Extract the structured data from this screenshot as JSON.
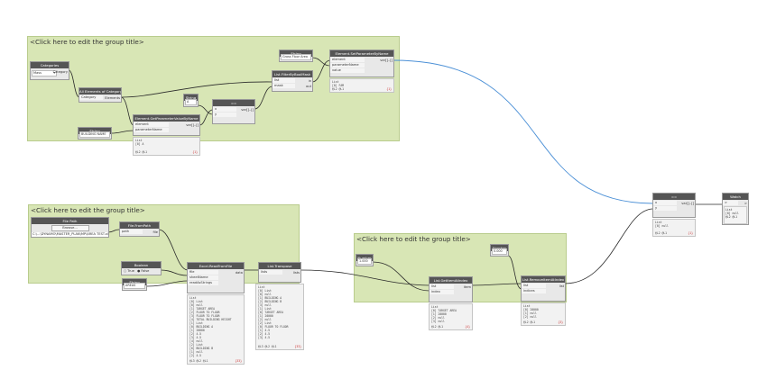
{
  "groups": [
    {
      "title": "<Click here to edit the group title>"
    },
    {
      "title": "<Click here to edit the group title>"
    },
    {
      "title": "<Click here to edit the group title>"
    }
  ],
  "nodes": {
    "categories": {
      "title": "Categories",
      "value": "Mass",
      "out": "Category"
    },
    "all_elements": {
      "title": "All Elements of Category",
      "in": "Category",
      "out": "Elements"
    },
    "string_building": {
      "title": "String",
      "value": "BUILDING NAME",
      "out": ">"
    },
    "get_param": {
      "title": "Element.GetParameterValueByName",
      "in1": "element",
      "in2": "parameterName",
      "out": "var[]..[]"
    },
    "string_a": {
      "title": "String",
      "value": "A",
      "out": ">"
    },
    "equals": {
      "title": "==",
      "in1": "x",
      "in2": "y",
      "out": "var[]..[]"
    },
    "filter_bool": {
      "title": "List.FilterByBoolMask",
      "in1": "list",
      "in2": "mask",
      "out1": "in",
      "out2": "out"
    },
    "string_gross": {
      "title": "String",
      "value": "Gross Floor Area",
      "out": ">"
    },
    "set_param": {
      "title": "Element.SetParameterByName",
      "in1": "element",
      "in2": "parameterName",
      "in3": "value",
      "out": "var[]..[]"
    },
    "file_path": {
      "title": "File Path",
      "button": "Browse...",
      "path": "C:\\...\\DYNAMO\\MASTER_PLAN\\MP\\AREA TEST.xlsx"
    },
    "file_from_path": {
      "title": "File.FromPath",
      "in": "path",
      "out": "file"
    },
    "boolean": {
      "title": "Boolean",
      "opt_true": "True",
      "opt_false": "False"
    },
    "string_areas": {
      "title": "String",
      "value": "AREAS",
      "out": ">"
    },
    "excel_read": {
      "title": "Excel.ReadFromFile",
      "in1": "file",
      "in2": "sheetName",
      "in3": "readAsStrings",
      "out": "data"
    },
    "list_transpose": {
      "title": "List.Transpose",
      "in": "lists",
      "out": "lists"
    },
    "number_1": {
      "title": "Number",
      "value": "1.000",
      "out": ">"
    },
    "list_get_item": {
      "title": "List.GetItemAtIndex",
      "in1": "list",
      "in2": "index",
      "out": "item"
    },
    "number_0": {
      "title": "Number",
      "value": "0.000",
      "out": ">"
    },
    "list_remove_item": {
      "title": "List.RemoveItemAtIndex",
      "in1": "list",
      "in2": "indices",
      "out": "list"
    },
    "equals_right": {
      "title": "==",
      "in1": "x",
      "in2": "y",
      "out": "var[]..[]"
    },
    "watch": {
      "title": "Watch",
      "in": ">",
      "out": ">"
    }
  },
  "previews": {
    "get_param": {
      "lines": [
        "List",
        "  [0] A"
      ],
      "tail": "@L2 @L1",
      "flag": "{1}"
    },
    "set_param": {
      "lines": [
        "List",
        "  [0] FAM"
      ],
      "tail": "@L2 @L1",
      "flag": "{1}"
    },
    "excel_read": {
      "lines": [
        "List",
        "  [0] List",
        "    [0] null",
        "    [1] TARGET AREA",
        "    [2] FLOOR TO FLOOR",
        "    [3] FLOOR TO FLOOR",
        "    [4] TOTAL BUILDING HEIGHT",
        "  [1] List",
        "    [0] BUILDING A",
        "    [1] 20000",
        "    [2] 4.5",
        "    [3] 4.5",
        "    [4] null",
        "  [2] List",
        "    [0] BUILDING B",
        "    [1] null",
        "    [2] 4.5"
      ],
      "tail": "@L3 @L2 @L1",
      "flag": "{33}"
    },
    "list_transpose": {
      "lines": [
        "List",
        "  [0] List",
        "    [0] null",
        "    [1] BUILDING A",
        "    [2] BUILDING B",
        "    [3] null",
        "  [1] List",
        "    [0] TARGET AREA",
        "    [1] 20000",
        "    [2] null",
        "  [2] List",
        "    [0] FLOOR TO FLOOR",
        "    [1] 4.5",
        "    [2] 4.5",
        "    [3] 4.5"
      ],
      "tail": "@L3 @L2 @L1",
      "flag": "{33}"
    },
    "list_get_item": {
      "lines": [
        "List",
        "  [0] TARGET AREA",
        "  [1] 20000",
        "  [2] null",
        "  [3] null"
      ],
      "tail": "@L2 @L1",
      "flag": "{4}"
    },
    "list_remove_item": {
      "lines": [
        "List",
        "  [0] 20000",
        "  [1] null",
        "  [2] null"
      ],
      "tail": "@L2 @L1",
      "flag": "{3}"
    },
    "equals_right": {
      "lines": [
        "List",
        "  [0] null"
      ],
      "tail": "@L2 @L1",
      "flag": "{1}"
    },
    "watch": {
      "lines": [
        "List",
        "  [0] null"
      ],
      "tail": "@L2 @L1",
      "flag": ""
    }
  },
  "colors": {
    "group": "#d8e6b5",
    "wire": "#2a2a2a",
    "watch_wire": "#4a8fd6",
    "header": "#555555"
  }
}
